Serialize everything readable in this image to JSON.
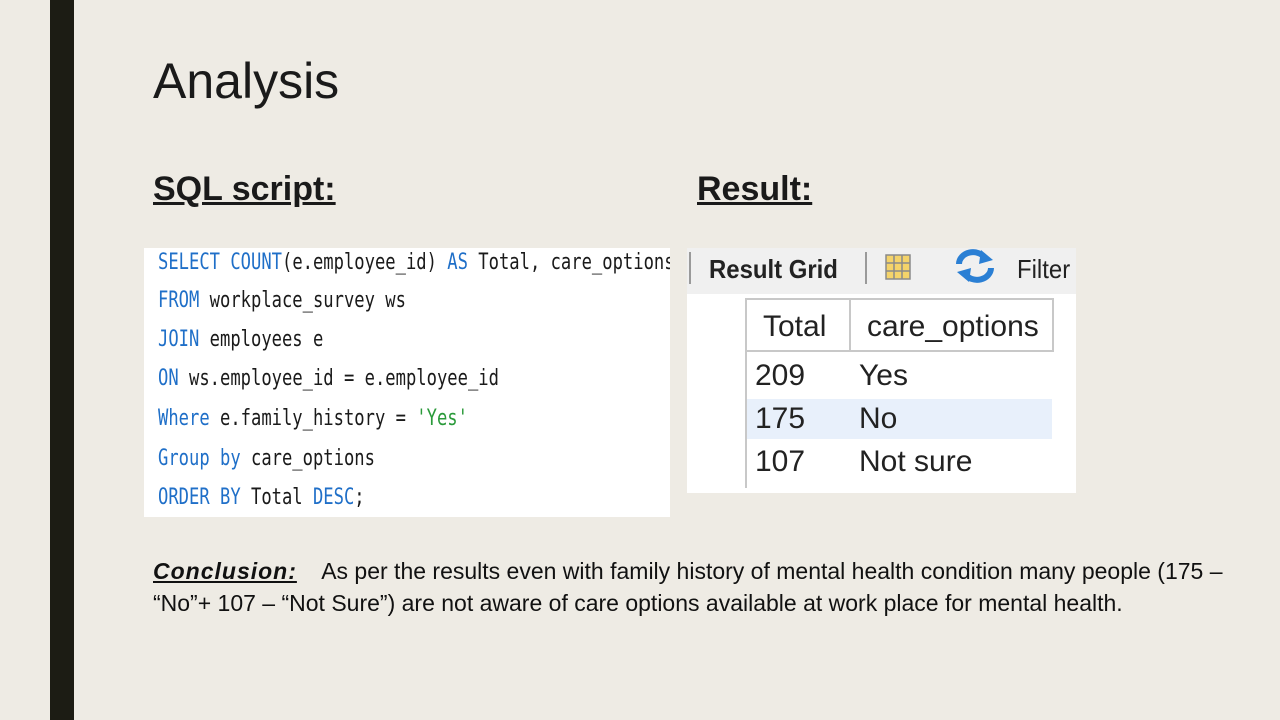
{
  "slide": {
    "title": "Analysis",
    "sql_heading": "SQL script:",
    "result_heading": "Result:"
  },
  "sql": {
    "lines": [
      [
        {
          "t": "SELECT ",
          "c": "kw"
        },
        {
          "t": "COUNT",
          "c": "kw"
        },
        {
          "t": "(e.employee_id) ",
          "c": ""
        },
        {
          "t": "AS",
          "c": "kw"
        },
        {
          "t": " Total, care_options",
          "c": ""
        }
      ],
      [
        {
          "t": "FROM",
          "c": "kw"
        },
        {
          "t": " workplace_survey ws",
          "c": ""
        }
      ],
      [
        {
          "t": "JOIN",
          "c": "kw"
        },
        {
          "t": " employees e",
          "c": ""
        }
      ],
      [
        {
          "t": "ON",
          "c": "kw"
        },
        {
          "t": " ws.employee_id = e.employee_id",
          "c": ""
        }
      ],
      [
        {
          "t": "Where",
          "c": "kw"
        },
        {
          "t": " e.family_history = ",
          "c": ""
        },
        {
          "t": "'Yes'",
          "c": "str"
        }
      ],
      [
        {
          "t": "Group by",
          "c": "kw"
        },
        {
          "t": " care_options",
          "c": ""
        }
      ],
      [
        {
          "t": "ORDER BY",
          "c": "kw"
        },
        {
          "t": " Total ",
          "c": ""
        },
        {
          "t": "DESC",
          "c": "kw"
        },
        {
          "t": ";",
          "c": ""
        }
      ]
    ]
  },
  "result_grid": {
    "toolbar_label": "Result Grid",
    "filter_label": "Filter",
    "columns": [
      "Total",
      "care_options"
    ],
    "rows": [
      {
        "total": "209",
        "care_options": "Yes"
      },
      {
        "total": "175",
        "care_options": "No"
      },
      {
        "total": "107",
        "care_options": "Not sure"
      }
    ],
    "selected_row": 1
  },
  "conclusion": {
    "label": "Conclusion:",
    "text": "As per the results even with family history of mental health condition many people (175 – “No”+ 107 – “Not Sure”)  are not aware of care options available at work place for mental health."
  },
  "colors": {
    "background": "#eeebe4",
    "left_bar": "#1c1c14",
    "sql_keyword": "#1f6fc8",
    "sql_string": "#2a9a3a"
  }
}
